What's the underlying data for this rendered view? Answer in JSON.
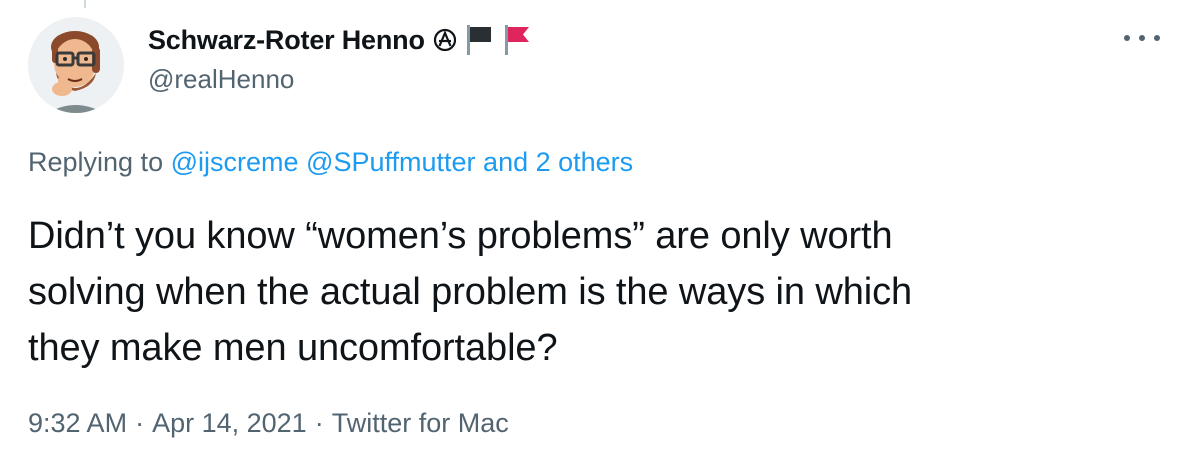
{
  "author": {
    "display_name": "Schwarz-Roter Henno",
    "badge_symbol": "Ⓐ",
    "handle": "@realHenno",
    "flags": [
      "black-flag-icon",
      "red-flag-icon"
    ]
  },
  "reply": {
    "prefix": "Replying to",
    "mention1": "@ijscreme",
    "mention2": "@SPuffmutter",
    "and_others": "and 2 others"
  },
  "tweet": {
    "line1": "Didn’t you know “women’s problems” are only worth",
    "line2": "solving when the actual problem is the ways in which",
    "line3": "they make men uncomfortable?"
  },
  "meta": {
    "time": "9:32 AM",
    "separator": "·",
    "date": "Apr 14, 2021",
    "source": "Twitter for Mac"
  },
  "colors": {
    "link": "#1d9bf0",
    "secondary_text": "#536471",
    "primary_text": "#0f1419",
    "red_flag": "#e0245e",
    "black_flag": "#292f33"
  }
}
